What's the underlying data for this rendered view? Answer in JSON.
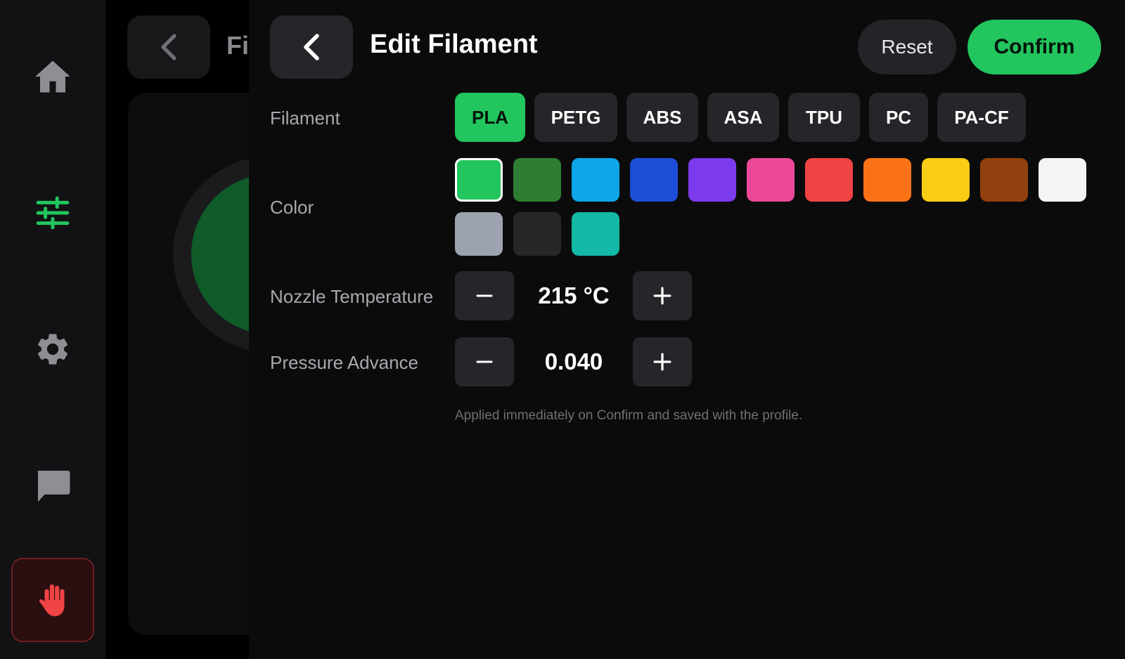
{
  "sidebar": {
    "items": [
      {
        "name": "home",
        "icon": "home-icon",
        "active": false
      },
      {
        "name": "tune",
        "icon": "sliders-icon",
        "active": true
      },
      {
        "name": "settings",
        "icon": "gear-icon",
        "active": false
      },
      {
        "name": "messages",
        "icon": "chat-icon",
        "active": false
      }
    ],
    "emergency_stop_icon": "hand-stop-icon",
    "active_color": "#22c55e",
    "inactive_color": "#8e8e93",
    "stop_color": "#ef4444"
  },
  "background_screen": {
    "title_fragment": "Fi"
  },
  "header": {
    "title": "Edit Filament",
    "reset_label": "Reset",
    "confirm_label": "Confirm"
  },
  "filament": {
    "label": "Filament",
    "selected": "PLA",
    "options": [
      "PLA",
      "PETG",
      "ABS",
      "ASA",
      "TPU",
      "PC",
      "PA-CF"
    ]
  },
  "color": {
    "label": "Color",
    "selected_index": 0,
    "swatches": [
      "#22c55e",
      "#2e7d32",
      "#0ea5e9",
      "#1d4ed8",
      "#7c3aed",
      "#ec4899",
      "#ef4444",
      "#f97316",
      "#facc15",
      "#92400e",
      "#f4f4f5",
      "#9ca3af",
      "#27272a",
      "#14b8a6"
    ]
  },
  "nozzle": {
    "label": "Nozzle Temperature",
    "value": "215 °C",
    "minus": "−",
    "plus": "+"
  },
  "pressure": {
    "label": "Pressure Advance",
    "value": "0.040",
    "minus": "−",
    "plus": "+"
  },
  "hint": "Applied immediately on Confirm and saved with the profile."
}
